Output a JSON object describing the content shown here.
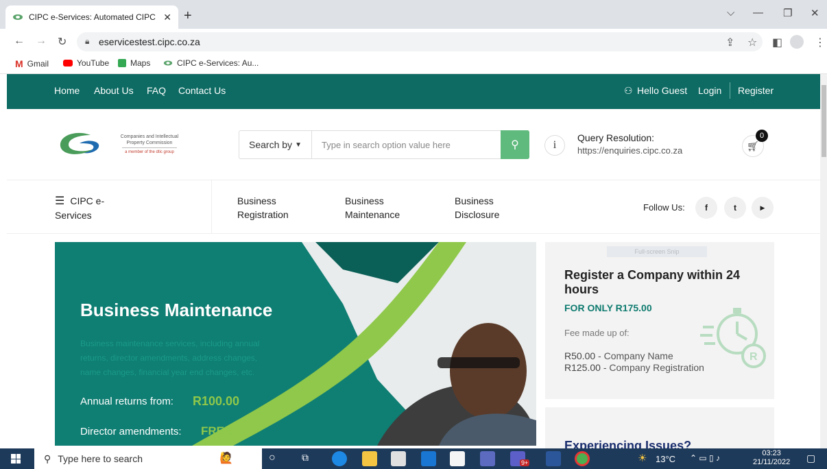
{
  "browser": {
    "tab_title": "CIPC e-Services: Automated CIPC",
    "url": "eservicestest.cipc.co.za",
    "bookmarks": [
      "Gmail",
      "YouTube",
      "Maps",
      "CIPC e-Services: Au..."
    ]
  },
  "site_nav": {
    "links": [
      "Home",
      "About Us",
      "FAQ",
      "Contact Us"
    ],
    "greeting": "Hello Guest",
    "login": "Login",
    "register": "Register"
  },
  "header": {
    "logo_line1": "Companies and Intellectual",
    "logo_line2": "Property Commission",
    "logo_line3": "a member of the dtic group",
    "search_by": "Search by",
    "search_placeholder": "Type in search option value here",
    "query_title": "Query Resolution:",
    "query_url": "https://enquiries.cipc.co.za",
    "cart_count": "0"
  },
  "menu": {
    "eservices_line1": "CIPC e-",
    "eservices_line2": "Services",
    "items": [
      {
        "line1": "Business",
        "line2": "Registration"
      },
      {
        "line1": "Business",
        "line2": "Maintenance"
      },
      {
        "line1": "Business",
        "line2": "Disclosure"
      }
    ],
    "follow_us": "Follow Us:",
    "social": [
      "f",
      "t",
      "▶"
    ]
  },
  "hero": {
    "title": "Business Maintenance",
    "desc_1": "Business maintenance services, including annual",
    "desc_2": "returns, director amendments, address changes,",
    "desc_3": "name changes, financial year end changes, etc.",
    "annual_label": "Annual returns from:",
    "annual_value": "R100.00",
    "director_label": "Director amendments:",
    "director_value": "FREE"
  },
  "card1": {
    "overlay": "Full-screen Snip",
    "title_1": "Register a Company within 24",
    "title_2": "hours",
    "price": "FOR ONLY R175.00",
    "fee_label": "Fee made up of:",
    "fee1_amount": "R50.00",
    "fee1_desc": " - Company Name",
    "fee2_amount": "R125.00",
    "fee2_desc": " - Company Registration"
  },
  "card2": {
    "title": "Experiencing Issues?"
  },
  "taskbar": {
    "search": "Type here to search",
    "temp": "13°C",
    "time": "03:23",
    "date": "21/11/2022",
    "teams_badge": "9+"
  }
}
